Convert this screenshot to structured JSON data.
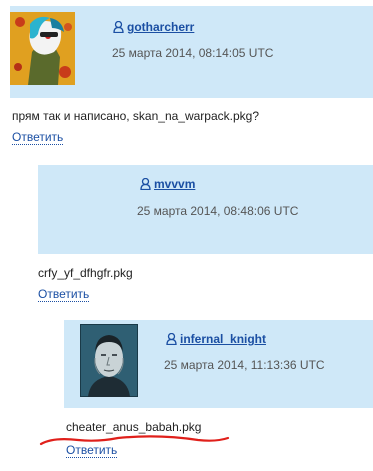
{
  "comments": [
    {
      "username": "gotharcherr",
      "date": "25 марта 2014, 08:14:05 UTC",
      "text": "прям так и написано, skan_na_warpack.pkg?",
      "reply_label": "Ответить",
      "avatar": "pony-avatar"
    },
    {
      "username": "mvvvm",
      "date": "25 марта 2014, 08:48:06 UTC",
      "text": "crfy_yf_dfhgfr.pkg",
      "reply_label": "Ответить",
      "avatar": "none"
    },
    {
      "username": "infernal_knight",
      "date": "25 марта 2014, 11:13:36 UTC",
      "text": "cheater_anus_babah.pkg",
      "reply_label": "Ответить",
      "avatar": "man-portrait-avatar"
    }
  ],
  "colors": {
    "header_bg": "#cfe8f8",
    "link": "#1b4fa3",
    "annotation": "#e0201b"
  }
}
